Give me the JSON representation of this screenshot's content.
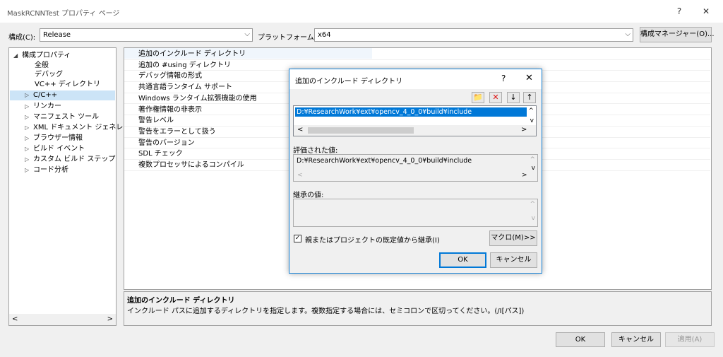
{
  "window": {
    "title": "MaskRCNNTest プロパティ ページ",
    "help_glyph": "?",
    "close_glyph": "✕"
  },
  "toolbar": {
    "config_label": "構成(C):",
    "config_value": "Release",
    "platform_label": "プラットフォーム(P):",
    "platform_value": "x64",
    "config_manager_label": "構成マネージャー(O)...",
    "dropdown_glyph": "⌵"
  },
  "tree": {
    "root": "構成プロパティ",
    "items": [
      {
        "label": "全般"
      },
      {
        "label": "デバッグ"
      },
      {
        "label": "VC++ ディレクトリ"
      },
      {
        "label": "C/C++"
      },
      {
        "label": "リンカー"
      },
      {
        "label": "マニフェスト ツール"
      },
      {
        "label": "XML ドキュメント ジェネレーター"
      },
      {
        "label": "ブラウザー情報"
      },
      {
        "label": "ビルド イベント"
      },
      {
        "label": "カスタム ビルド ステップ"
      },
      {
        "label": "コード分析"
      }
    ],
    "collapse_glyph": "◢",
    "expand_glyph": "▷",
    "scroll_left": "<",
    "scroll_right": ">"
  },
  "properties": {
    "rows": [
      {
        "name": "追加のインクルード ディレクトリ"
      },
      {
        "name": "追加の #using ディレクトリ"
      },
      {
        "name": "デバッグ情報の形式"
      },
      {
        "name": "共通言語ランタイム サポート"
      },
      {
        "name": "Windows ランタイム拡張機能の使用"
      },
      {
        "name": "著作権情報の非表示"
      },
      {
        "name": "警告レベル"
      },
      {
        "name": "警告をエラーとして扱う"
      },
      {
        "name": "警告のバージョン"
      },
      {
        "name": "SDL チェック"
      },
      {
        "name": "複数プロセッサによるコンパイル"
      }
    ]
  },
  "description": {
    "title": "追加のインクルード ディレクトリ",
    "text": "インクルード パスに追加するディレクトリを指定します。複数指定する場合には、セミコロンで区切ってください。(/I[パス])"
  },
  "footer": {
    "ok": "OK",
    "cancel": "キャンセル",
    "apply": "適用(A)"
  },
  "dialog": {
    "title": "追加のインクルード ディレクトリ",
    "help_glyph": "?",
    "close_glyph": "✕",
    "icons": {
      "new_folder": "📁",
      "delete": "✕",
      "move_down": "↓",
      "move_up": "↑"
    },
    "list_entry": "D:¥ResearchWork¥ext¥opencv_4_0_0¥build¥include",
    "evaluated_label": "評価された値:",
    "evaluated_value": "D:¥ResearchWork¥ext¥opencv_4_0_0¥build¥include",
    "inherited_label": "継承の値:",
    "inherit_checkbox_label": "親またはプロジェクトの既定値から継承(I)",
    "inherit_checked": "✓",
    "macro_button": "マクロ(M)>>",
    "ok": "OK",
    "cancel": "キャンセル",
    "scroll_left": "<",
    "scroll_right": ">",
    "scroll_up": "^",
    "scroll_down": "v"
  }
}
